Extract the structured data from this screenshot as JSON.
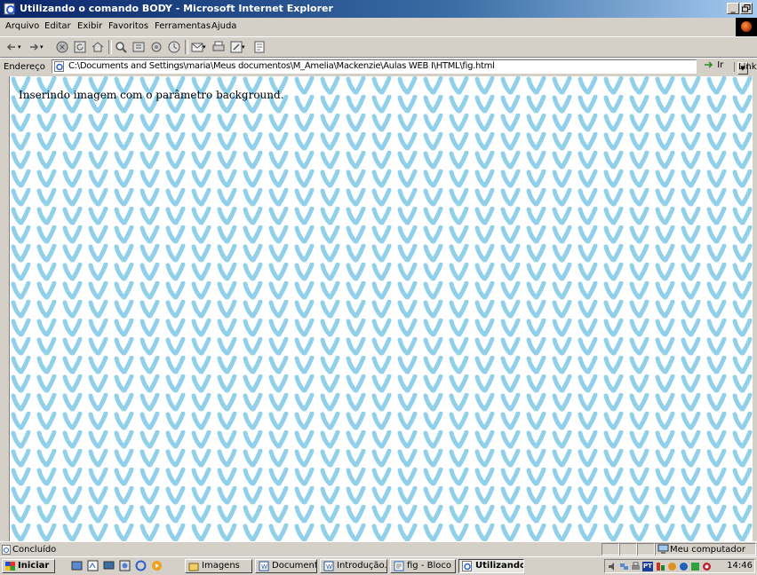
{
  "window": {
    "title": "Utilizando o comando BODY - Microsoft Internet Explorer",
    "controls": [
      "_",
      "Х"
    ]
  },
  "menu": [
    "Arquivo",
    "Editar",
    "Exibir",
    "Favoritos",
    "Ferramentas",
    "Ajuda"
  ],
  "address": {
    "label": "Endereço",
    "url": "C:\\Documents and Settings\\maria\\Meus documentos\\M_Amelia\\Mackenzie\\Aulas WEB I\\HTML\\fig.html",
    "go_label": "Ir",
    "links_label": "Links"
  },
  "page": {
    "text": "Inserindo imagem com o parâmetro background."
  },
  "status": {
    "text": "Concluído",
    "zone": "Meu computador"
  },
  "taskbar": {
    "start_label": "Iniciar",
    "tasks": [
      {
        "label": "Imagens",
        "active": false
      },
      {
        "label": "Document...",
        "active": false
      },
      {
        "label": "Introdução...",
        "active": false
      },
      {
        "label": "fig - Bloco ...",
        "active": false
      },
      {
        "label": "Utilizando...",
        "active": true
      }
    ],
    "clock": "14:46",
    "language": "PT"
  },
  "colors": {
    "pattern": "#90d0ea",
    "titlebar": "#0a246a"
  }
}
